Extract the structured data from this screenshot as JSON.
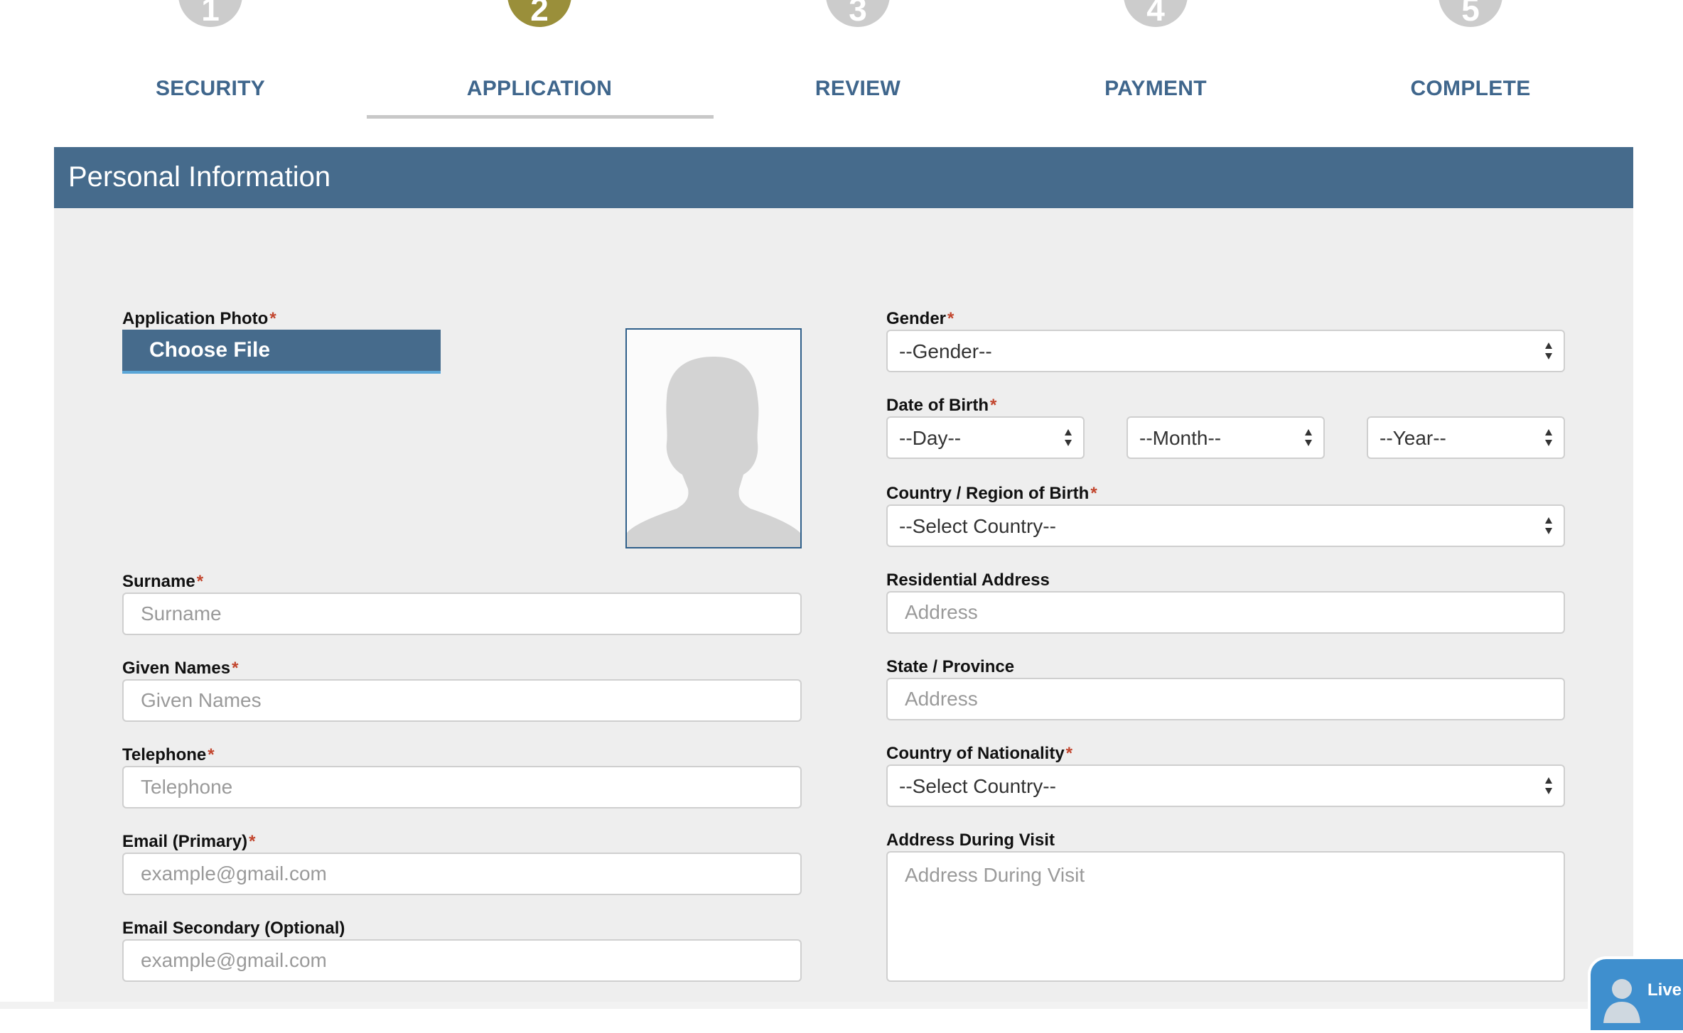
{
  "stepper": {
    "steps": [
      {
        "number": "1",
        "label": "SECURITY"
      },
      {
        "number": "2",
        "label": "APPLICATION"
      },
      {
        "number": "3",
        "label": "REVIEW"
      },
      {
        "number": "4",
        "label": "PAYMENT"
      },
      {
        "number": "5",
        "label": "COMPLETE"
      }
    ],
    "active_step": 2
  },
  "panel": {
    "title": "Personal Information"
  },
  "form": {
    "required_marker": "*",
    "photo": {
      "label": "Application Photo",
      "button": "Choose File",
      "preview_icon": "person-silhouette-icon"
    },
    "surname": {
      "label": "Surname",
      "placeholder": "Surname"
    },
    "given_names": {
      "label": "Given Names",
      "placeholder": "Given Names"
    },
    "telephone": {
      "label": "Telephone",
      "placeholder": "Telephone"
    },
    "email_primary": {
      "label": "Email (Primary)",
      "placeholder": "example@gmail.com"
    },
    "email_secondary": {
      "label": "Email Secondary (Optional)",
      "placeholder": "example@gmail.com"
    },
    "gender": {
      "label": "Gender",
      "selected": "--Gender--"
    },
    "dob": {
      "label": "Date of Birth",
      "day": "--Day--",
      "month": "--Month--",
      "year": "--Year--"
    },
    "country_birth": {
      "label": "Country / Region of Birth",
      "selected": "--Select Country--"
    },
    "residential_address": {
      "label": "Residential Address",
      "placeholder": "Address"
    },
    "state": {
      "label": "State / Province",
      "placeholder": "Address"
    },
    "nationality": {
      "label": "Country of Nationality",
      "selected": "--Select Country--"
    },
    "address_visit": {
      "label": "Address During Visit",
      "placeholder": "Address During Visit"
    }
  },
  "live_chat": {
    "label": "Live"
  },
  "colors": {
    "step_active": "#9a8f3a",
    "step_inactive": "#cccccc",
    "step_label": "#3f668c",
    "header_bg": "#466b8c",
    "required": "#c2452d",
    "live_chat": "#3f8fce"
  }
}
